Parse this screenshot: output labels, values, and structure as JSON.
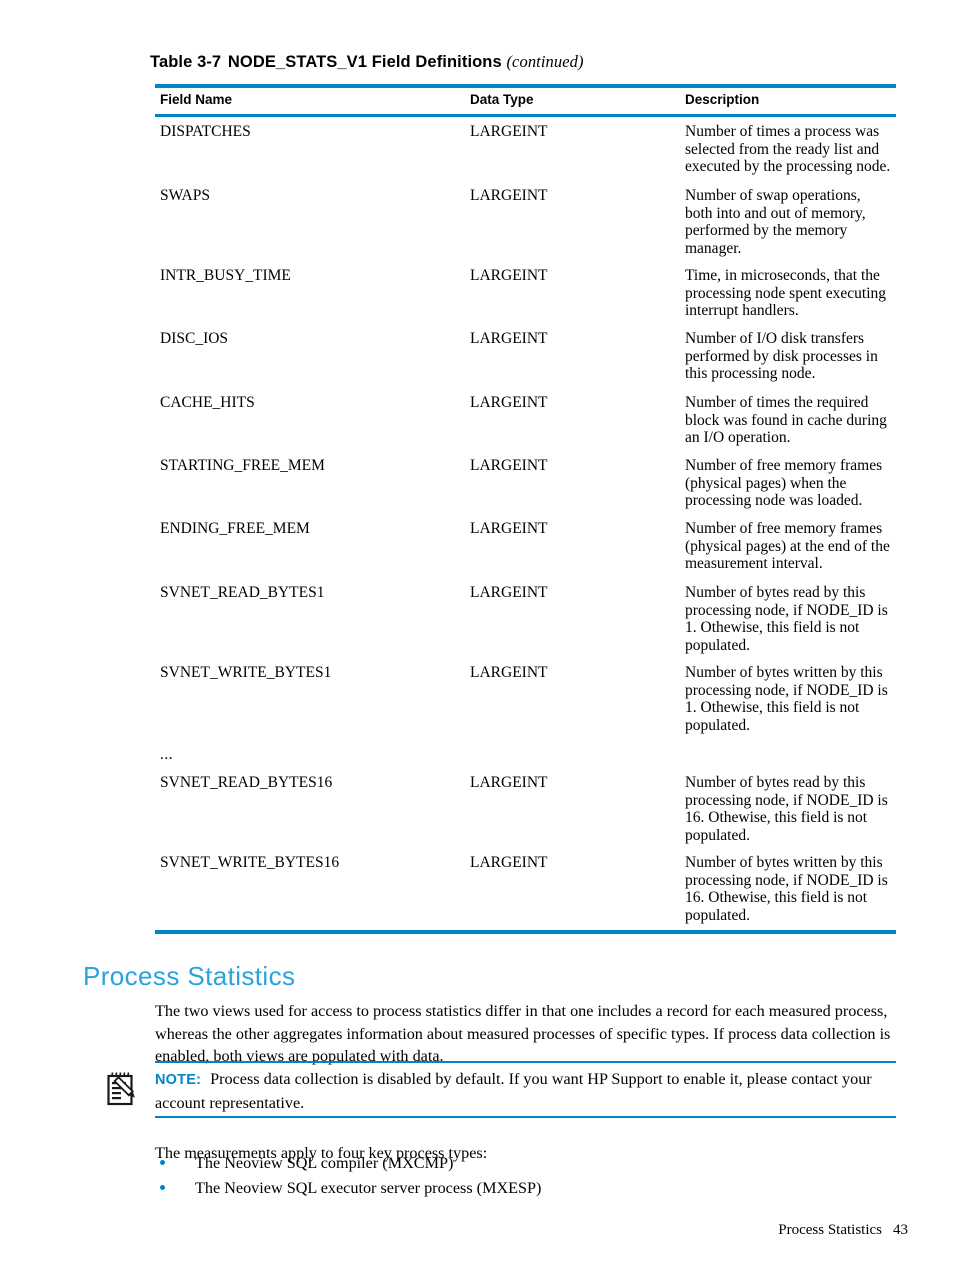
{
  "table": {
    "caption_label": "Table",
    "caption_number": "3-7",
    "caption_title": "NODE_STATS_V1 Field Definitions",
    "caption_continued": "(continued)",
    "accent_color": "#0086c6",
    "columns": [
      "Field Name",
      "Data Type",
      "Description"
    ],
    "rows": [
      {
        "field": "DISPATCHES",
        "type": "LARGEINT",
        "description": "Number of times a process was selected from the ready list and executed by the processing node."
      },
      {
        "field": "SWAPS",
        "type": "LARGEINT",
        "description": "Number of swap operations, both into and out of memory, performed by the memory manager."
      },
      {
        "field": "INTR_BUSY_TIME",
        "type": "LARGEINT",
        "description": "Time, in microseconds, that the processing node spent executing interrupt handlers."
      },
      {
        "field": "DISC_IOS",
        "type": "LARGEINT",
        "description": "Number of I/O disk transfers performed by disk processes in this processing node."
      },
      {
        "field": "CACHE_HITS",
        "type": "LARGEINT",
        "description": "Number of times the required block was found in cache during an I/O operation."
      },
      {
        "field": "STARTING_FREE_MEM",
        "type": "LARGEINT",
        "description": "Number of free memory frames (physical pages) when the processing node was loaded."
      },
      {
        "field": "ENDING_FREE_MEM",
        "type": "LARGEINT",
        "description": "Number of free memory frames (physical pages) at the end of the measurement interval."
      },
      {
        "field": "SVNET_READ_BYTES1",
        "type": "LARGEINT",
        "description": "Number of bytes read by this processing node, if NODE_ID is 1. Othewise, this field is not populated."
      },
      {
        "field": "SVNET_WRITE_BYTES1",
        "type": "LARGEINT",
        "description": "Number of bytes written by this processing node, if NODE_ID is 1. Othewise, this field is not populated."
      },
      {
        "field": "SVNET_READ_BYTES16",
        "type": "LARGEINT",
        "description": "Number of bytes read by this processing node, if NODE_ID is 16. Othewise, this field is not populated."
      },
      {
        "field": "SVNET_WRITE_BYTES16",
        "type": "LARGEINT",
        "description": "Number of bytes written by this processing node, if NODE_ID is 16. Othewise, this field is not populated."
      }
    ],
    "ellipsis": "..."
  },
  "section": {
    "heading": "Process Statistics",
    "heading_color": "#29a3dc",
    "intro_paragraph": "The two views used for access to process statistics differ in that one includes a record for each measured process, whereas the other aggregates information about measured processes of specific types. If process data collection is enabled, both views are populated with data.",
    "apply_paragraph": "The measurements apply to four key process types:"
  },
  "note": {
    "label": "NOTE:",
    "label_color": "#0086c6",
    "icon": "note-pad-pencil-icon",
    "text": "Process data collection is disabled by default. If you want HP Support to enable it, please contact your account representative."
  },
  "bullets": [
    "The Neoview SQL compiler (MXCMP)",
    "The Neoview SQL executor server process (MXESP)"
  ],
  "footer": {
    "title": "Process Statistics",
    "page_number": "43"
  }
}
